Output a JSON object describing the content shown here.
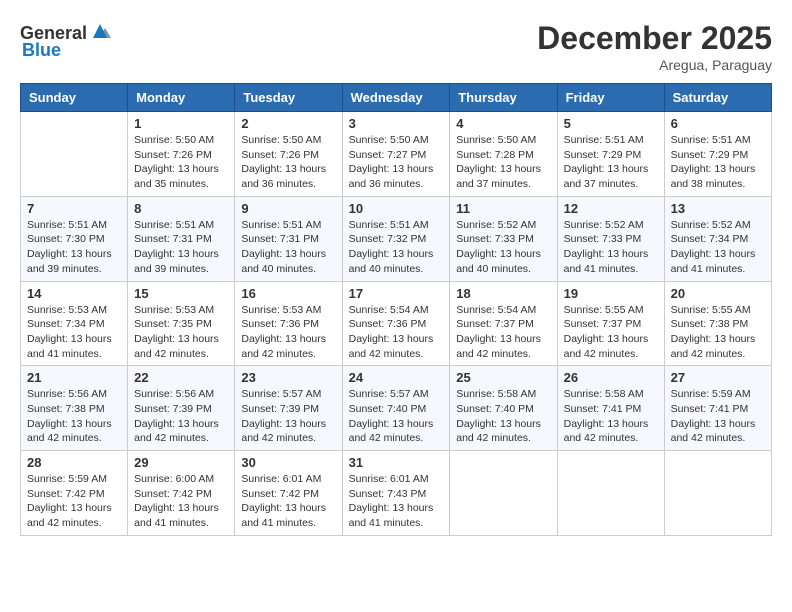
{
  "header": {
    "logo_general": "General",
    "logo_blue": "Blue",
    "month_title": "December 2025",
    "location": "Aregua, Paraguay"
  },
  "weekdays": [
    "Sunday",
    "Monday",
    "Tuesday",
    "Wednesday",
    "Thursday",
    "Friday",
    "Saturday"
  ],
  "weeks": [
    [
      {
        "day": "",
        "info": ""
      },
      {
        "day": "1",
        "info": "Sunrise: 5:50 AM\nSunset: 7:26 PM\nDaylight: 13 hours\nand 35 minutes."
      },
      {
        "day": "2",
        "info": "Sunrise: 5:50 AM\nSunset: 7:26 PM\nDaylight: 13 hours\nand 36 minutes."
      },
      {
        "day": "3",
        "info": "Sunrise: 5:50 AM\nSunset: 7:27 PM\nDaylight: 13 hours\nand 36 minutes."
      },
      {
        "day": "4",
        "info": "Sunrise: 5:50 AM\nSunset: 7:28 PM\nDaylight: 13 hours\nand 37 minutes."
      },
      {
        "day": "5",
        "info": "Sunrise: 5:51 AM\nSunset: 7:29 PM\nDaylight: 13 hours\nand 37 minutes."
      },
      {
        "day": "6",
        "info": "Sunrise: 5:51 AM\nSunset: 7:29 PM\nDaylight: 13 hours\nand 38 minutes."
      }
    ],
    [
      {
        "day": "7",
        "info": "Sunrise: 5:51 AM\nSunset: 7:30 PM\nDaylight: 13 hours\nand 39 minutes."
      },
      {
        "day": "8",
        "info": "Sunrise: 5:51 AM\nSunset: 7:31 PM\nDaylight: 13 hours\nand 39 minutes."
      },
      {
        "day": "9",
        "info": "Sunrise: 5:51 AM\nSunset: 7:31 PM\nDaylight: 13 hours\nand 40 minutes."
      },
      {
        "day": "10",
        "info": "Sunrise: 5:51 AM\nSunset: 7:32 PM\nDaylight: 13 hours\nand 40 minutes."
      },
      {
        "day": "11",
        "info": "Sunrise: 5:52 AM\nSunset: 7:33 PM\nDaylight: 13 hours\nand 40 minutes."
      },
      {
        "day": "12",
        "info": "Sunrise: 5:52 AM\nSunset: 7:33 PM\nDaylight: 13 hours\nand 41 minutes."
      },
      {
        "day": "13",
        "info": "Sunrise: 5:52 AM\nSunset: 7:34 PM\nDaylight: 13 hours\nand 41 minutes."
      }
    ],
    [
      {
        "day": "14",
        "info": "Sunrise: 5:53 AM\nSunset: 7:34 PM\nDaylight: 13 hours\nand 41 minutes."
      },
      {
        "day": "15",
        "info": "Sunrise: 5:53 AM\nSunset: 7:35 PM\nDaylight: 13 hours\nand 42 minutes."
      },
      {
        "day": "16",
        "info": "Sunrise: 5:53 AM\nSunset: 7:36 PM\nDaylight: 13 hours\nand 42 minutes."
      },
      {
        "day": "17",
        "info": "Sunrise: 5:54 AM\nSunset: 7:36 PM\nDaylight: 13 hours\nand 42 minutes."
      },
      {
        "day": "18",
        "info": "Sunrise: 5:54 AM\nSunset: 7:37 PM\nDaylight: 13 hours\nand 42 minutes."
      },
      {
        "day": "19",
        "info": "Sunrise: 5:55 AM\nSunset: 7:37 PM\nDaylight: 13 hours\nand 42 minutes."
      },
      {
        "day": "20",
        "info": "Sunrise: 5:55 AM\nSunset: 7:38 PM\nDaylight: 13 hours\nand 42 minutes."
      }
    ],
    [
      {
        "day": "21",
        "info": "Sunrise: 5:56 AM\nSunset: 7:38 PM\nDaylight: 13 hours\nand 42 minutes."
      },
      {
        "day": "22",
        "info": "Sunrise: 5:56 AM\nSunset: 7:39 PM\nDaylight: 13 hours\nand 42 minutes."
      },
      {
        "day": "23",
        "info": "Sunrise: 5:57 AM\nSunset: 7:39 PM\nDaylight: 13 hours\nand 42 minutes."
      },
      {
        "day": "24",
        "info": "Sunrise: 5:57 AM\nSunset: 7:40 PM\nDaylight: 13 hours\nand 42 minutes."
      },
      {
        "day": "25",
        "info": "Sunrise: 5:58 AM\nSunset: 7:40 PM\nDaylight: 13 hours\nand 42 minutes."
      },
      {
        "day": "26",
        "info": "Sunrise: 5:58 AM\nSunset: 7:41 PM\nDaylight: 13 hours\nand 42 minutes."
      },
      {
        "day": "27",
        "info": "Sunrise: 5:59 AM\nSunset: 7:41 PM\nDaylight: 13 hours\nand 42 minutes."
      }
    ],
    [
      {
        "day": "28",
        "info": "Sunrise: 5:59 AM\nSunset: 7:42 PM\nDaylight: 13 hours\nand 42 minutes."
      },
      {
        "day": "29",
        "info": "Sunrise: 6:00 AM\nSunset: 7:42 PM\nDaylight: 13 hours\nand 41 minutes."
      },
      {
        "day": "30",
        "info": "Sunrise: 6:01 AM\nSunset: 7:42 PM\nDaylight: 13 hours\nand 41 minutes."
      },
      {
        "day": "31",
        "info": "Sunrise: 6:01 AM\nSunset: 7:43 PM\nDaylight: 13 hours\nand 41 minutes."
      },
      {
        "day": "",
        "info": ""
      },
      {
        "day": "",
        "info": ""
      },
      {
        "day": "",
        "info": ""
      }
    ]
  ]
}
